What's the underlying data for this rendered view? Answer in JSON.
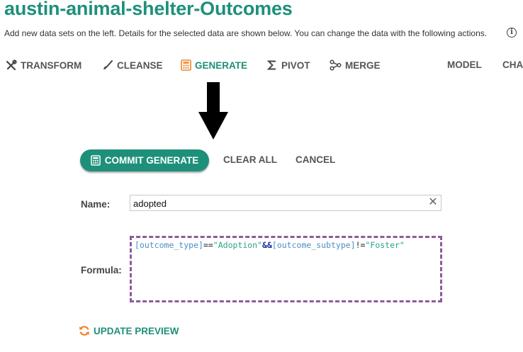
{
  "header": {
    "title": "austin-animal-shelter-Outcomes",
    "subtitle": "Add new data sets on the left.  Details for the selected data are shown below.  You can change the data with the following actions."
  },
  "toolbar": {
    "items": [
      {
        "label": "TRANSFORM",
        "icon": "tools-icon"
      },
      {
        "label": "CLEANSE",
        "icon": "brush-icon"
      },
      {
        "label": "GENERATE",
        "icon": "calculator-icon",
        "active": true
      },
      {
        "label": "PIVOT",
        "icon": "sigma-icon"
      },
      {
        "label": "MERGE",
        "icon": "merge-icon"
      },
      {
        "label": "MODEL"
      },
      {
        "label": "CHA"
      }
    ]
  },
  "actions": {
    "commit_label": "COMMIT GENERATE",
    "clear_label": "CLEAR ALL",
    "cancel_label": "CANCEL"
  },
  "form": {
    "name_label": "Name:",
    "name_value": "adopted",
    "formula_label": "Formula:",
    "formula_tokens": {
      "field1": "[outcome_type]",
      "op1": "==",
      "str1": "\"Adoption\"",
      "and": "&&",
      "field2": "[outcome_subtype]",
      "op2": "!=",
      "str2": "\"Foster\""
    }
  },
  "update_preview_label": "UPDATE PREVIEW",
  "colors": {
    "accent": "#1e9079",
    "active_icon": "#f0842c",
    "formula_border": "#8e5a9a"
  }
}
